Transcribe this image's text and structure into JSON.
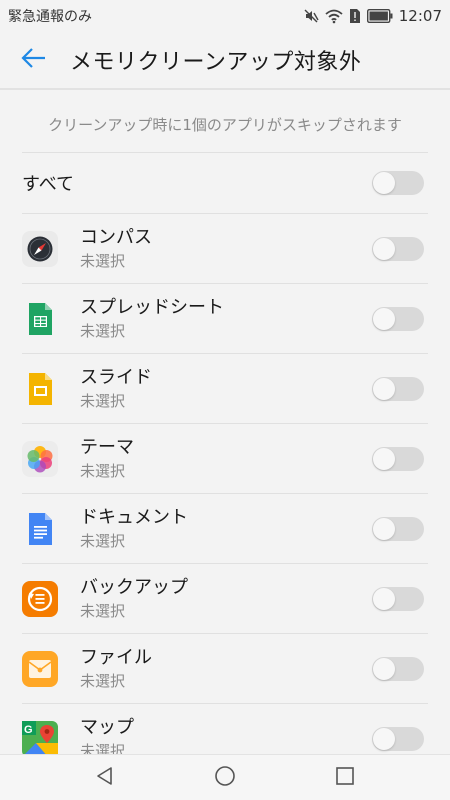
{
  "status_bar": {
    "carrier": "緊急通報のみ",
    "time": "12:07"
  },
  "header": {
    "title": "メモリクリーンアップ対象外"
  },
  "subtitle": "クリーンアップ時に1個のアプリがスキップされます",
  "all_item": {
    "label": "すべて",
    "enabled": false
  },
  "apps": [
    {
      "name": "コンパス",
      "status": "未選択",
      "icon": "compass-icon",
      "enabled": false
    },
    {
      "name": "スプレッドシート",
      "status": "未選択",
      "icon": "sheets-icon",
      "enabled": false
    },
    {
      "name": "スライド",
      "status": "未選択",
      "icon": "slides-icon",
      "enabled": false
    },
    {
      "name": "テーマ",
      "status": "未選択",
      "icon": "themes-icon",
      "enabled": false
    },
    {
      "name": "ドキュメント",
      "status": "未選択",
      "icon": "docs-icon",
      "enabled": false
    },
    {
      "name": "バックアップ",
      "status": "未選択",
      "icon": "backup-icon",
      "enabled": false
    },
    {
      "name": "ファイル",
      "status": "未選択",
      "icon": "files-icon",
      "enabled": false
    },
    {
      "name": "マップ",
      "status": "未選択",
      "icon": "maps-icon",
      "enabled": false
    }
  ],
  "colors": {
    "accent": "#1e88e5",
    "toggle_off": "#d9d9d9",
    "secondary_text": "#8a8a8a"
  }
}
